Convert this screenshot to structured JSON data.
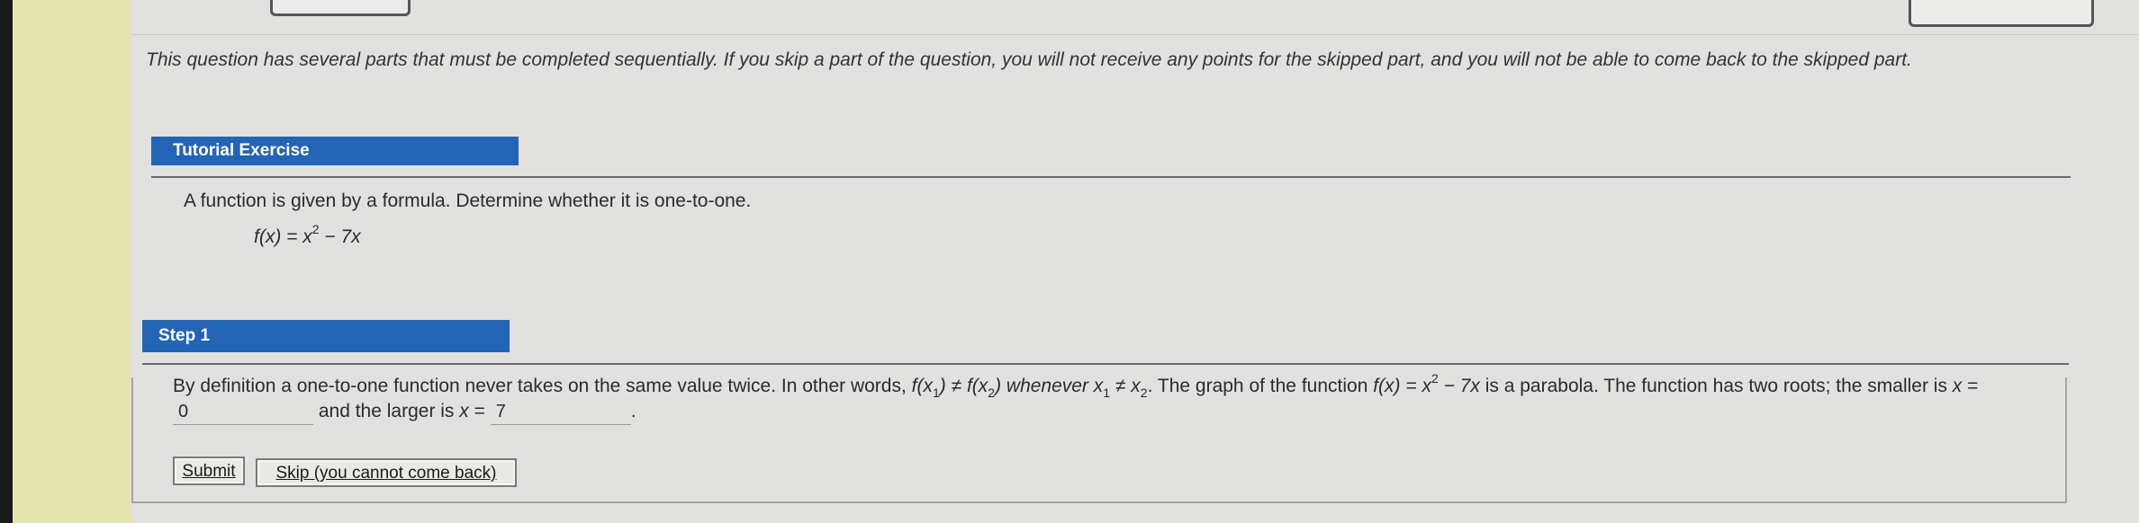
{
  "notice": {
    "text": "This question has several parts that must be completed sequentially. If you skip a part of the question, you will not receive any points for the skipped part, and you will not be able to come back to the skipped part."
  },
  "tutorial": {
    "header": "Tutorial Exercise",
    "prompt": "A function is given by a formula. Determine whether it is one-to-one.",
    "formula_lhs": "f(x) = x",
    "formula_exp": "2",
    "formula_rhs": " − 7x"
  },
  "step1": {
    "header": "Step 1",
    "text_a": "By definition a one-to-one function never takes on the same value twice. In other words, ",
    "text_b": "f(x",
    "sub1": "1",
    "text_c": ") ≠ f(x",
    "sub2": "2",
    "text_d": ") whenever x",
    "sub3": "1",
    "text_e": " ≠ x",
    "sub4": "2",
    "text_f": ". The graph of the function ",
    "text_g": "f(x) = x",
    "exp": "2",
    "text_h": " − 7x",
    "text_i": " is a parabola. The function has two roots; the smaller is ",
    "text_j": "x",
    "text_k": " = ",
    "answer_smaller": "0",
    "text_l": " and the larger is ",
    "text_m": "x",
    "text_n": " = ",
    "answer_larger": "7",
    "text_o": "."
  },
  "buttons": {
    "submit": "Submit",
    "skip": "Skip (you cannot come back)"
  }
}
